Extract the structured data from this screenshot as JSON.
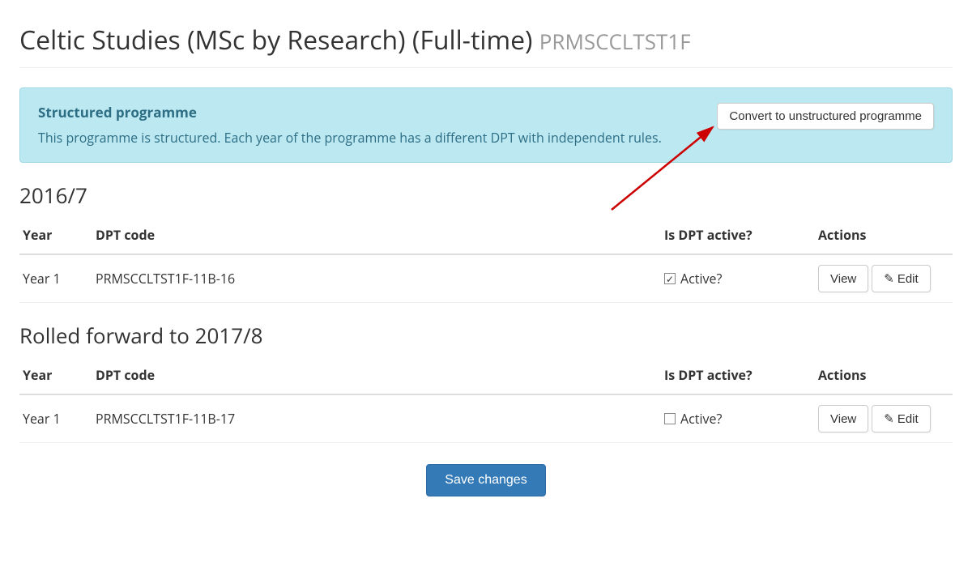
{
  "page": {
    "title": "Celtic Studies (MSc by Research) (Full-time)",
    "code": "PRMSCCLTST1F"
  },
  "info": {
    "heading": "Structured programme",
    "body": "This programme is structured. Each year of the programme has a different DPT with independent rules.",
    "convert_label": "Convert to unstructured programme"
  },
  "columns": {
    "year": "Year",
    "dpt_code": "DPT code",
    "is_active": "Is DPT active?",
    "actions": "Actions"
  },
  "labels": {
    "active_checkbox": "Active?",
    "view": "View",
    "edit": "Edit",
    "save": "Save changes"
  },
  "sections": [
    {
      "title": "2016/7",
      "rows": [
        {
          "year": "Year 1",
          "code": "PRMSCCLTST1F-11B-16",
          "active": true
        }
      ]
    },
    {
      "title": "Rolled forward to 2017/8",
      "rows": [
        {
          "year": "Year 1",
          "code": "PRMSCCLTST1F-11B-17",
          "active": false
        }
      ]
    }
  ]
}
